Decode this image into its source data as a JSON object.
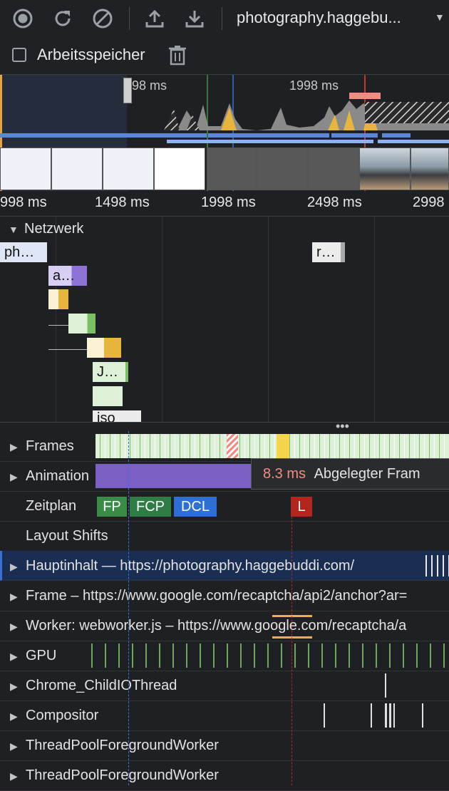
{
  "toolbar": {
    "record_icon": "record-icon",
    "reload_icon": "reload-icon",
    "clear_icon": "clear-icon",
    "upload_icon": "upload-icon",
    "download_icon": "download-icon",
    "url": "photography.haggebu...",
    "memory_label": "Arbeitsspeicher",
    "memory_checked": false
  },
  "overview": {
    "label_left": "98 ms",
    "label_right": "1998 ms"
  },
  "ruler": [
    "998 ms",
    "1498 ms",
    "1998 ms",
    "2498 ms",
    "2998"
  ],
  "network": {
    "title": "Netzwerk",
    "requests": [
      "ph…",
      "r…",
      "a…",
      "J…",
      "jso"
    ]
  },
  "tracks": {
    "frames": "Frames",
    "animation": "Animation",
    "zeitplan": "Zeitplan",
    "layout_shifts": "Layout Shifts",
    "main": "Hauptinhalt — https://photography.haggebuddi.com/",
    "frame": "Frame – https://www.google.com/recaptcha/api2/anchor?ar=",
    "worker": "Worker: webworker.js – https://www.google.com/recaptcha/a",
    "gpu": "GPU",
    "childio": "Chrome_ChildIOThread",
    "compositor": "Compositor",
    "pool1": "ThreadPoolForegroundWorker",
    "pool2": "ThreadPoolForegroundWorker"
  },
  "markers": {
    "fp": "FP",
    "fcp": "FCP",
    "dcl": "DCL",
    "l": "L"
  },
  "tooltip": {
    "time": "8.3 ms",
    "text": "Abgelegter Fram"
  },
  "colors": {
    "background": "#1f2023",
    "fp": "#3a8a48",
    "fcp": "#2f7d44",
    "dcl": "#2e6fd3",
    "load": "#b3261e",
    "animation": "#7b5fc4",
    "main_selected": "#1a2d52",
    "tooltip_time": "#f28b82"
  }
}
